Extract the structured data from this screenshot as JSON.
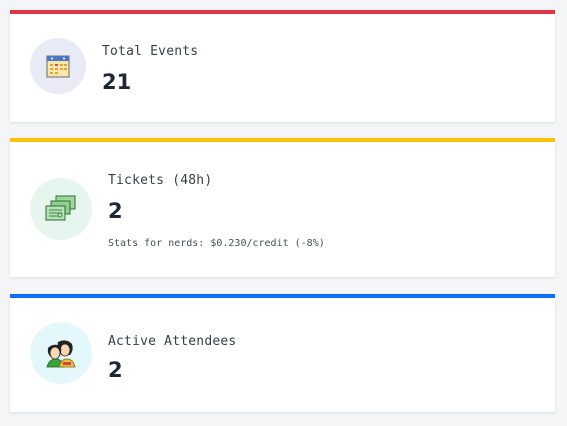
{
  "cards": [
    {
      "label": "Total Events",
      "value": "21",
      "accent": "#dc3545",
      "icon": "calendar-icon"
    },
    {
      "label": "Tickets (48h)",
      "value": "2",
      "subtext": "Stats for nerds: $0.230/credit (-8%)",
      "accent": "#ffc107",
      "icon": "tickets-icon"
    },
    {
      "label": "Active Attendees",
      "value": "2",
      "accent": "#0d6efd",
      "icon": "attendees-icon"
    }
  ]
}
